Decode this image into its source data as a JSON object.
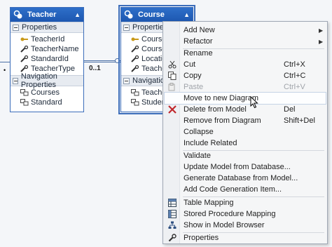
{
  "teacher": {
    "title": "Teacher",
    "properties_header": "Properties",
    "properties": [
      "TeacherId",
      "TeacherName",
      "StandardId",
      "TeacherType"
    ],
    "nav_header": "Navigation Properties",
    "nav": [
      "Courses",
      "Standard"
    ]
  },
  "course": {
    "title": "Course",
    "properties_header": "Properties",
    "properties": [
      "CourseI",
      "CourseN",
      "Location",
      "Teacher"
    ],
    "nav_header": "Navigation",
    "nav": [
      "Teacher",
      "Students"
    ]
  },
  "connector": {
    "multiplicity": "0..1"
  },
  "menu": {
    "add_new": "Add New",
    "refactor": "Refactor",
    "rename": "Rename",
    "cut": "Cut",
    "cut_sc": "Ctrl+X",
    "copy": "Copy",
    "copy_sc": "Ctrl+C",
    "paste": "Paste",
    "paste_sc": "Ctrl+V",
    "move_to_new_diagram": "Move to new Diagram",
    "delete_from_model": "Delete from Model",
    "delete_sc": "Del",
    "remove_from_diagram": "Remove from Diagram",
    "remove_sc": "Shift+Del",
    "collapse": "Collapse",
    "include_related": "Include Related",
    "validate": "Validate",
    "update_model": "Update Model from Database...",
    "generate_db": "Generate Database from Model...",
    "add_codegen": "Add Code Generation Item...",
    "table_mapping": "Table Mapping",
    "sp_mapping": "Stored Procedure Mapping",
    "show_in_browser": "Show in Model Browser",
    "properties": "Properties"
  }
}
